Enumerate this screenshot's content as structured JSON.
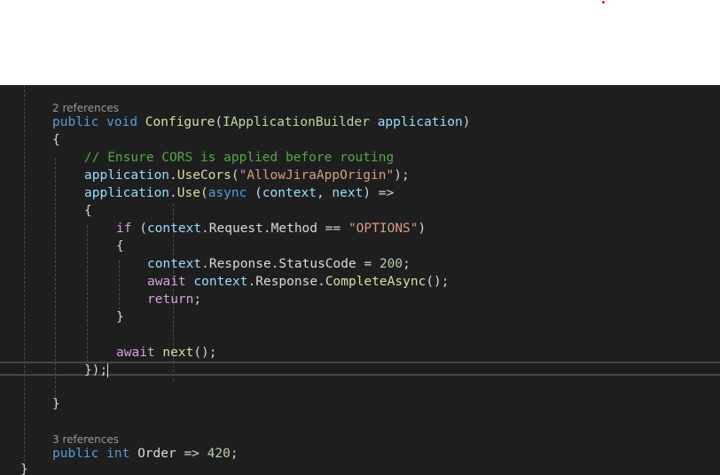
{
  "editor": {
    "lens_configure": "2 references",
    "lens_order": "3 references",
    "tokens": {
      "public": "public",
      "void": "void",
      "configure": "Configure",
      "open_paren": "(",
      "iapp_builder": "IApplicationBuilder",
      "application": "application",
      "close_paren": ")",
      "open_brace": "{",
      "close_brace": "}",
      "comment": "// Ensure CORS is applied before routing",
      "use_cors": "UseCors",
      "cors_arg": "\"AllowJiraAppOrigin\"",
      "dot": ".",
      "paren_semicolon": ");",
      "use": "Use",
      "async": "async",
      "context": "context",
      "comma": ",",
      "next": "next",
      "arrow_close": ") =>",
      "if": "if",
      "if_open": " (",
      "request": "Request",
      "method": "Method",
      "eq": " == ",
      "options_str": "\"OPTIONS\"",
      "response": "Response",
      "status_code": "StatusCode",
      "assign": " = ",
      "status_value": "200",
      "semicolon": ";",
      "await": "await",
      "complete_async": "CompleteAsync",
      "call_empty": "();",
      "return": "return",
      "lambda_end": "});",
      "int": "int",
      "order": "Order",
      "fat_arrow": " => ",
      "order_value": "420",
      "class_close": "}"
    }
  }
}
